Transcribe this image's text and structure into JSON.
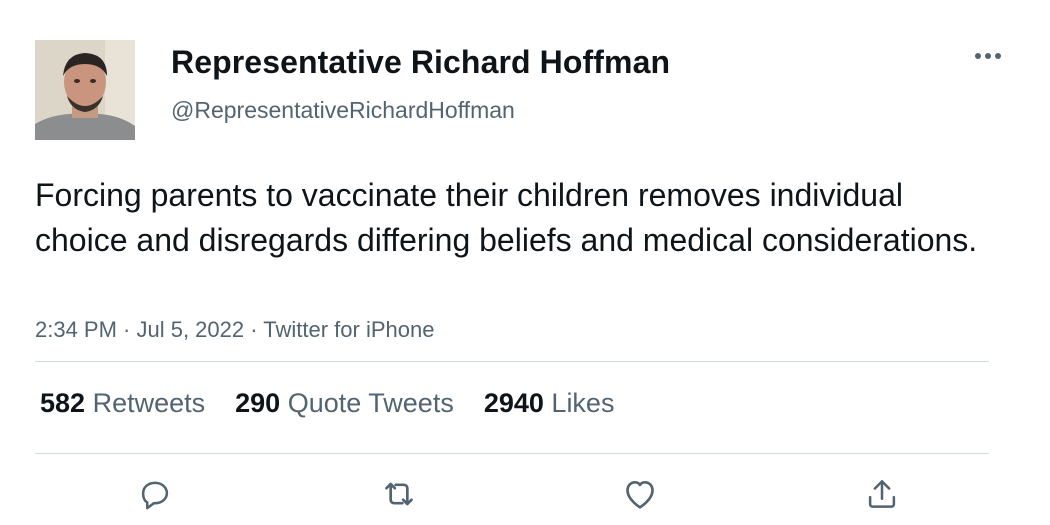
{
  "author": {
    "name": "Representative Richard Hoffman",
    "handle": "@RepresentativeRichardHoffman",
    "avatar_icon": "profile-photo"
  },
  "tweet": {
    "text": "Forcing parents to vaccinate their children removes individual choice and disregards differing beliefs and medical considerations.",
    "timestamp": "2:34 PM · Jul 5, 2022 · Twitter for iPhone"
  },
  "stats": {
    "retweets_count": "582",
    "retweets_label": "Retweets",
    "quotes_count": "290",
    "quotes_label": "Quote Tweets",
    "likes_count": "2940",
    "likes_label": "Likes"
  },
  "actions": {
    "reply_icon": "reply-icon",
    "retweet_icon": "retweet-icon",
    "like_icon": "heart-icon",
    "share_icon": "share-icon"
  },
  "colors": {
    "text_primary": "#0f1419",
    "text_secondary": "#536471",
    "divider": "#cfd9de"
  }
}
